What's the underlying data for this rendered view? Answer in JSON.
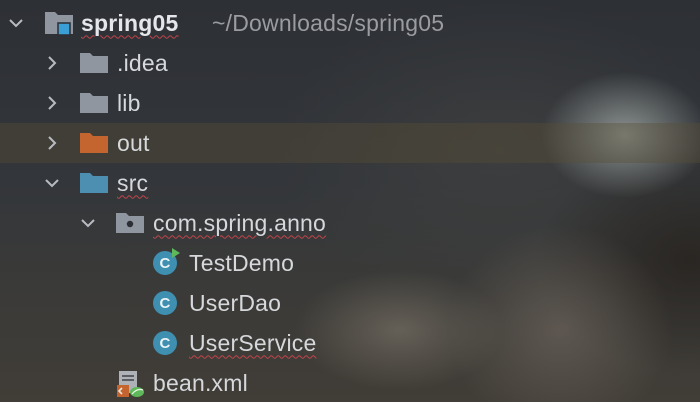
{
  "project": {
    "name": "spring05",
    "path": "~/Downloads/spring05"
  },
  "tree": {
    "idea": ".idea",
    "lib": "lib",
    "out": "out",
    "src": "src",
    "package": "com.spring.anno",
    "classes": [
      "TestDemo",
      "UserDao",
      "UserService"
    ],
    "bean_xml": "bean.xml"
  },
  "icons": {
    "folder": "folder-icon",
    "excluded_folder": "excluded-folder-icon",
    "source_folder": "source-folder-icon",
    "package": "package-icon",
    "class": "class-icon",
    "xml": "spring-xml-icon",
    "expand": "chevron-right-icon",
    "collapse": "chevron-down-icon"
  },
  "colors": {
    "folder": "#8f969f",
    "excluded": "#c4652f",
    "source": "#4c8fb0",
    "class": "#3f8fb0",
    "error_underline": "#c0454a"
  }
}
